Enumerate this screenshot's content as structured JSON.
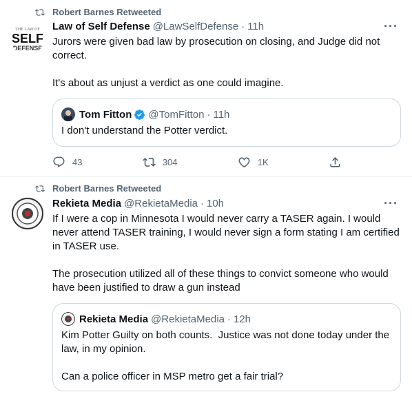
{
  "tweets": [
    {
      "retweeted_by": "Robert Barnes Retweeted",
      "author": {
        "name": "Law of Self Defense",
        "handle": "@LawSelfDefense",
        "time": "11h",
        "avatar_text": "THE LAW OF SELF DEFENSE"
      },
      "text": "Jurors were given bad law by prosecution on closing, and Judge did not correct.\n\nIt's about as unjust a verdict as one could imagine.",
      "quote": {
        "author": {
          "name": "Tom Fitton",
          "handle": "@TomFitton",
          "time": "11h",
          "verified": true
        },
        "text": "I don't understand the Potter verdict."
      },
      "actions": {
        "replies": "43",
        "retweets": "304",
        "likes": "1K"
      }
    },
    {
      "retweeted_by": "Robert Barnes Retweeted",
      "author": {
        "name": "Rekieta Media",
        "handle": "@RekietaMedia",
        "time": "10h"
      },
      "text": "If I were a cop in Minnesota I would never carry a TASER again. I would never attend TASER training, I would never sign a form stating I am certified in TASER use.\n\nThe prosecution utilized all of these things to convict someone who would have been justified to draw a gun instead",
      "quote": {
        "author": {
          "name": "Rekieta Media",
          "handle": "@RekietaMedia",
          "time": "12h"
        },
        "text": "Kim Potter Guilty on both counts.  Justice was not done today under the law, in my opinion.\n\nCan a police officer in MSP metro get a fair trial?"
      }
    }
  ],
  "ui": {
    "dot": "·",
    "more": "···"
  },
  "colors": {
    "secondary": "#536471",
    "verified_blue": "#1d9bf0",
    "border": "#cfd9de"
  }
}
